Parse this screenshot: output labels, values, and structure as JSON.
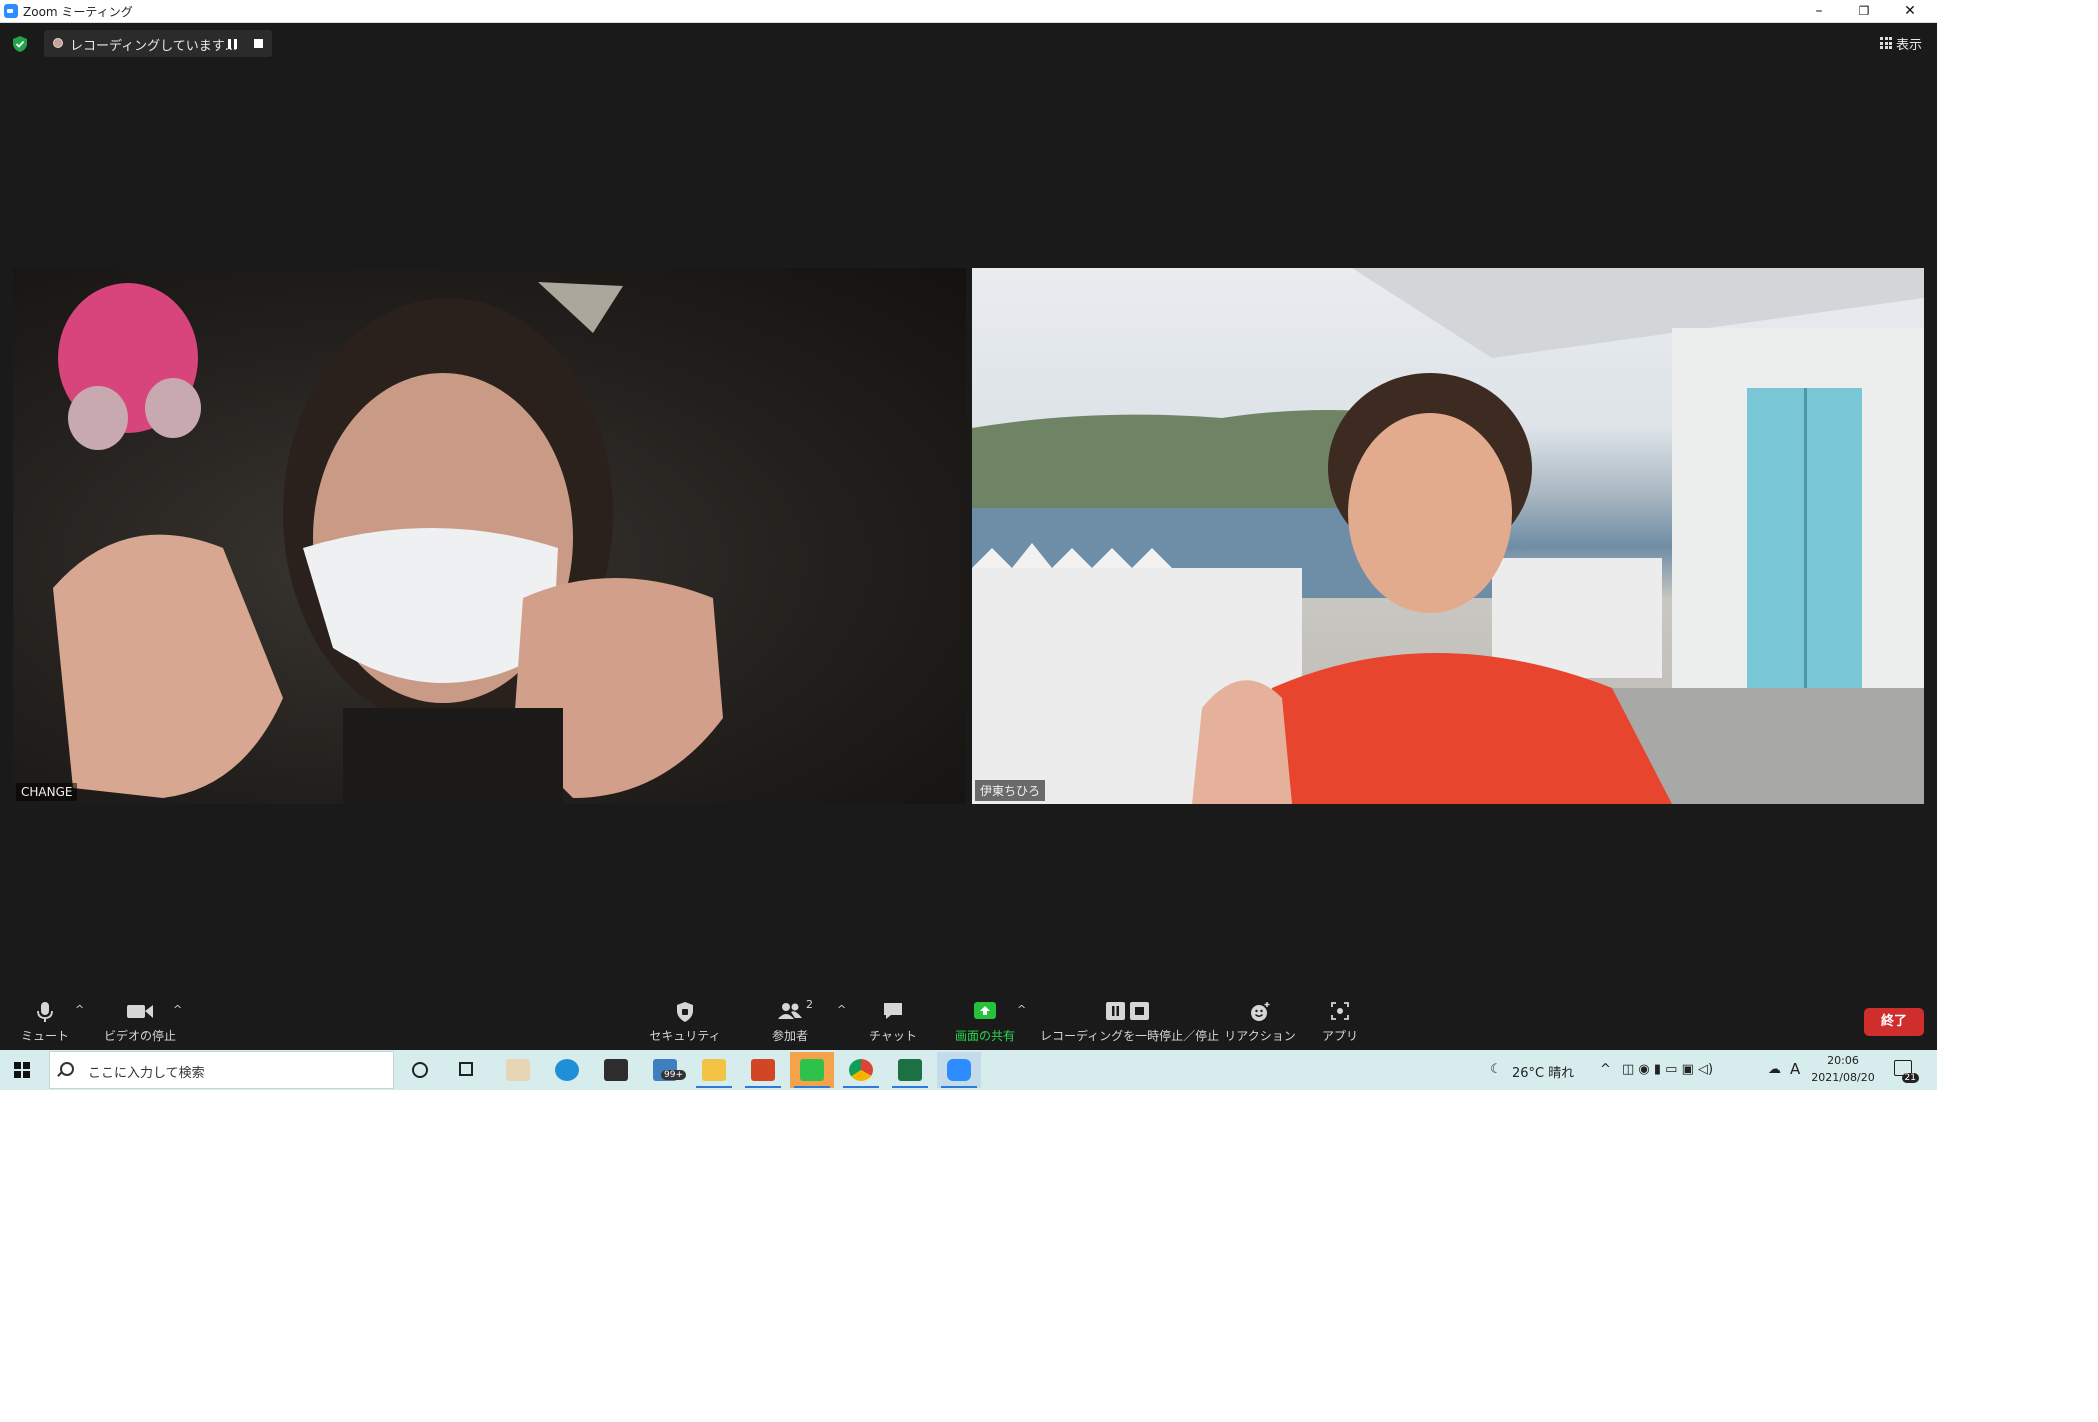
{
  "window": {
    "title": "Zoom ミーティング",
    "controls": [
      "–",
      "❐",
      "✕"
    ]
  },
  "topbar": {
    "recording_text": "レコーディングしています...",
    "view_label": "表示"
  },
  "participants": [
    {
      "name": "CHANGE"
    },
    {
      "name": "伊東ちひろ"
    }
  ],
  "toolbar": {
    "mute": "ミュート",
    "video": "ビデオの停止",
    "security": "セキュリティ",
    "participants": "参加者",
    "participants_count": "2",
    "chat": "チャット",
    "share": "画面の共有",
    "recording": "レコーディングを一時停止／停止",
    "reactions": "リアクション",
    "apps": "アプリ",
    "end": "終了"
  },
  "taskbar": {
    "search_placeholder": "ここに入力して検索",
    "mail_badge": "99+",
    "weather": "26°C  晴れ",
    "ime": "A",
    "time": "20:06",
    "date": "2021/08/20",
    "notifications": "21"
  },
  "colors": {
    "accent_share": "#26c23c",
    "end_button": "#d02d2d",
    "zoom_blue": "#2d8cff"
  }
}
